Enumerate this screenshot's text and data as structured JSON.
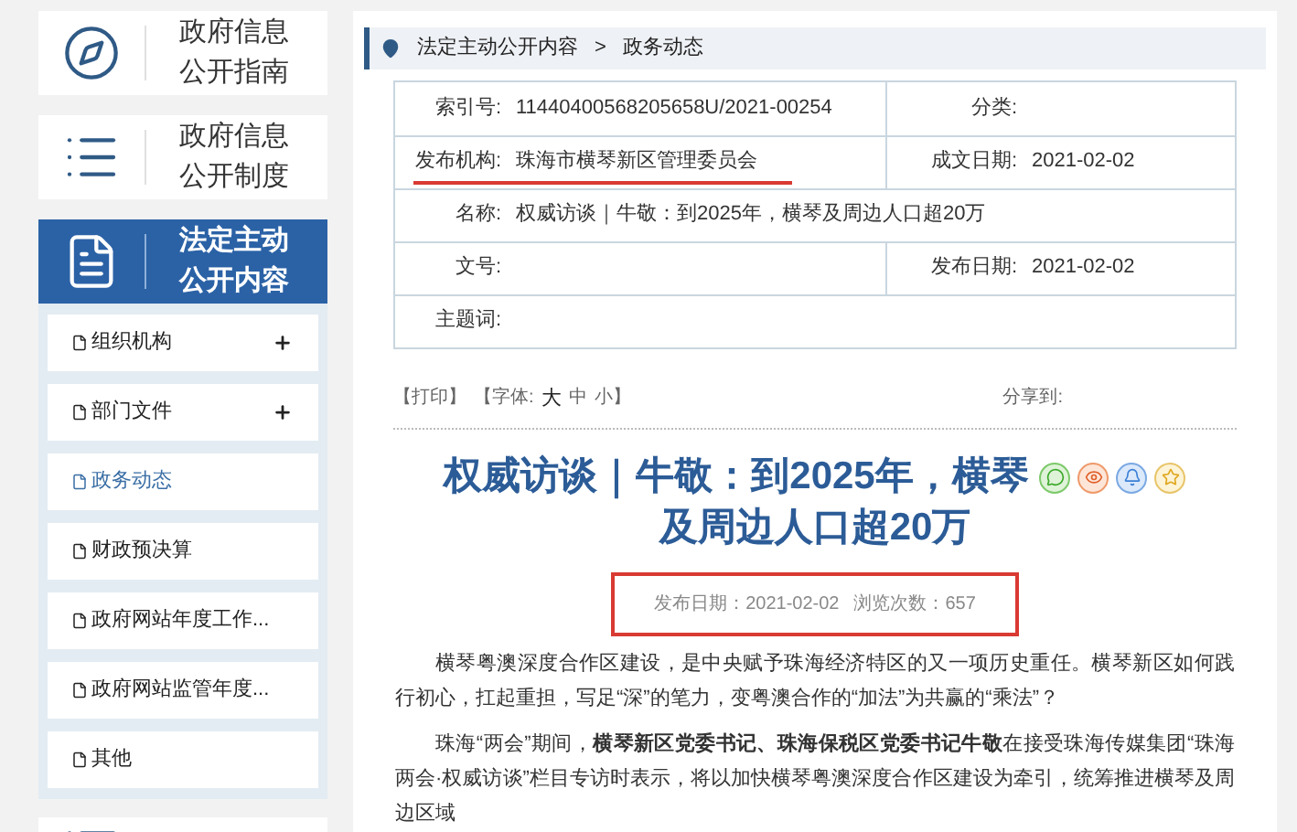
{
  "nav_cards": [
    {
      "kind": "compass",
      "lines": [
        "政府信息",
        "公开指南"
      ],
      "selected": false
    },
    {
      "kind": "list",
      "lines": [
        "政府信息",
        "公开制度"
      ],
      "selected": false
    },
    {
      "kind": "document",
      "lines": [
        "法定主动",
        "公开内容"
      ],
      "selected": true
    }
  ],
  "sub_items": [
    {
      "label": "组织机构",
      "expandable": true,
      "selected": false
    },
    {
      "label": "部门文件",
      "expandable": true,
      "selected": false
    },
    {
      "label": "政务动态",
      "expandable": false,
      "selected": true
    },
    {
      "label": "财政预决算",
      "expandable": false,
      "selected": false
    },
    {
      "label": "政府网站年度工作...",
      "expandable": false,
      "selected": false
    },
    {
      "label": "政府网站监管年度...",
      "expandable": false,
      "selected": false
    },
    {
      "label": "其他",
      "expandable": false,
      "selected": false
    }
  ],
  "nav_card_cut": {
    "kind": "list",
    "selected": false
  },
  "breadcrumb": {
    "items": [
      "法定主动公开内容",
      "政务动态"
    ],
    "separator": ">"
  },
  "meta_table": [
    {
      "cells": [
        {
          "label": "索引号:",
          "value": "11440400568205658U/2021-00254"
        },
        {
          "label": "分类:"
        }
      ],
      "underlined": false
    },
    {
      "cells": [
        {
          "label": "发布机构:",
          "value": "珠海市横琴新区管理委员会"
        },
        {
          "label": "成文日期:",
          "value": "2021-02-02"
        }
      ],
      "underlined": true
    },
    {
      "cells": [
        {
          "label": "名称:",
          "value": "权威访谈｜牛敬：到2025年，横琴及周边人口超20万"
        }
      ],
      "underlined": false
    },
    {
      "cells": [
        {
          "label": "文号:"
        },
        {
          "label": "发布日期:",
          "value": "2021-02-02"
        }
      ],
      "underlined": false
    },
    {
      "cells": [
        {
          "label": "主题词:"
        }
      ],
      "underlined": false
    }
  ],
  "toolbar": {
    "print": "【打印】",
    "font_label": "【字体:",
    "font_sizes": [
      "大",
      "中",
      "小"
    ],
    "font_close": "】",
    "share_label": "分享到:"
  },
  "article": {
    "title_lines": [
      "权威访谈｜牛敬：到2025年，横琴",
      "及周边人口超20万"
    ],
    "info": {
      "publish_date": "发布日期：2021-02-02",
      "views": "浏览次数：657",
      "boxed": true
    },
    "paragraphs": [
      "横琴粤澳深度合作区建设，是中央赋予珠海经济特区的又一项历史重任。横琴新区如何践行初心，扛起重担，写足“深”的笔力，变粤澳合作的“加法”为共赢的“乘法”？",
      "珠海“两会”期间，**横琴新区党委书记、珠海保税区党委书记牛敬**在接受珠海传媒集团“珠海两会·权威访谈”栏目专访时表示，将以加快横琴粤澳深度合作区建设为牵引，统筹推进横琴及周边区域"
    ]
  }
}
